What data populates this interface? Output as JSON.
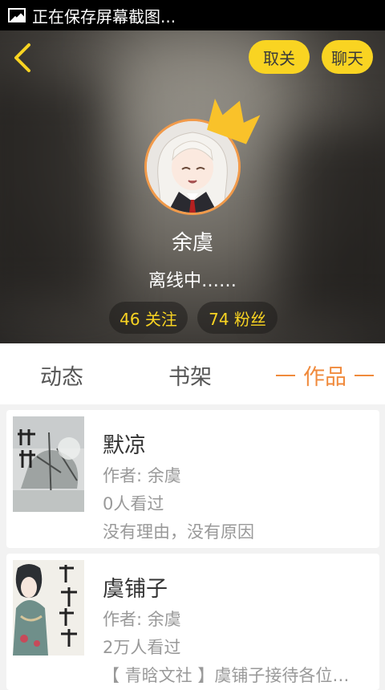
{
  "status_bar": {
    "text": "正在保存屏幕截图..."
  },
  "header": {
    "follow_button": "取关",
    "chat_button": "聊天"
  },
  "profile": {
    "username": "余虞",
    "status": "离线中……",
    "following": "46 关注",
    "fans": "74 粉丝"
  },
  "tabs": [
    "动态",
    "书架",
    "作品"
  ],
  "works": [
    {
      "title": "默凉",
      "author": "作者: 余虞",
      "views": "0人看过",
      "description": "没有理由，没有原因"
    },
    {
      "title": "虞铺子",
      "author": "作者: 余虞",
      "views": "2万人看过",
      "description": "【 青晗文社 】虞铺子接待各位…"
    }
  ],
  "colors": {
    "accent": "#f9d422",
    "tab_active": "#f08a3c",
    "avatar_border": "#f19a4a"
  }
}
